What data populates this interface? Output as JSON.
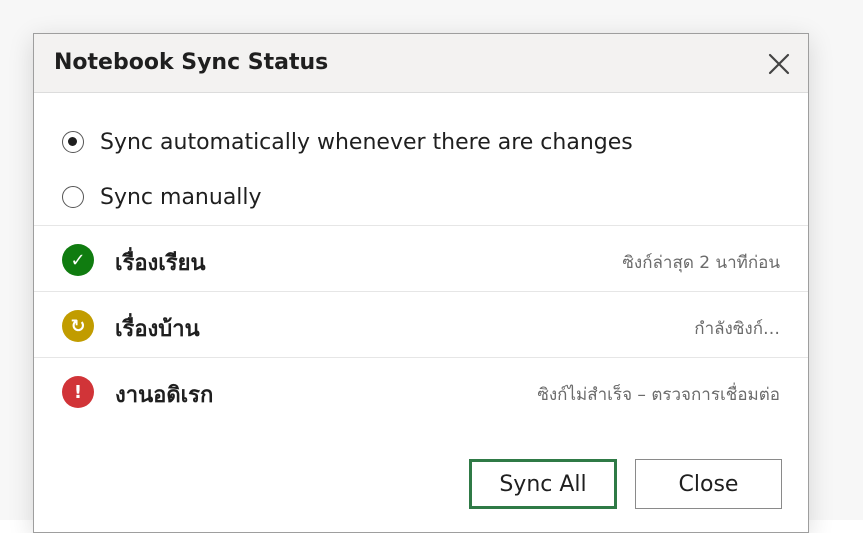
{
  "dialog": {
    "title": "Notebook Sync Status",
    "close_icon": "close-icon"
  },
  "sync_options": [
    {
      "label": "Sync automatically whenever there are changes",
      "selected": true
    },
    {
      "label": "Sync manually",
      "selected": false
    }
  ],
  "notebooks": [
    {
      "name": "เรื่องเรียน",
      "status": "ซิงก์ล่าสุด 2 นาทีก่อน",
      "icon": "check-icon",
      "glyph": "✓",
      "color": "#107c10"
    },
    {
      "name": "เรื่องบ้าน",
      "status": "กำลังซิงก์…",
      "icon": "syncing-icon",
      "glyph": "↻",
      "color": "#c19c00"
    },
    {
      "name": "งานอดิเรก",
      "status": "ซิงก์ไม่สำเร็จ – ตรวจการเชื่อมต่อ",
      "icon": "error-icon",
      "glyph": "!",
      "color": "#d13438"
    }
  ],
  "buttons": {
    "sync_all": "Sync All",
    "close": "Close"
  },
  "colors": {
    "accent": "#2f7a46",
    "titlebar": "#f3f2f1"
  }
}
